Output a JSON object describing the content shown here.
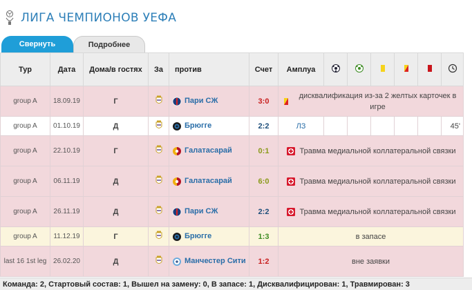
{
  "header": {
    "title": "ЛИГА ЧЕМПИОНОВ УЕФА"
  },
  "tabs": [
    {
      "label": "Свернуть",
      "active": true
    },
    {
      "label": "Подробнее",
      "active": false
    }
  ],
  "columns": {
    "round": "Тур",
    "date": "Дата",
    "home_away": "Дома/в гостях",
    "for": "За",
    "against": "против",
    "score": "Счет",
    "position": "Амплуа"
  },
  "rows": [
    {
      "round": "group A",
      "date": "18.09.19",
      "ha": "Г",
      "opponent": "Пари СЖ",
      "opp_icon": "psg-crest-icon",
      "score": "3:0",
      "score_color": "red",
      "note": "дисквалификация из-за 2 желтых карточек в игре",
      "note_icon": "yellow-red-card-icon",
      "style": "pink"
    },
    {
      "round": "group A",
      "date": "01.10.19",
      "ha": "Д",
      "opponent": "Брюгге",
      "opp_icon": "brugge-crest-icon",
      "score": "2:2",
      "score_color": "navy",
      "position": "ЛЗ",
      "minutes": "45'",
      "style": "white"
    },
    {
      "round": "group A",
      "date": "22.10.19",
      "ha": "Г",
      "opponent": "Галатасарай",
      "opp_icon": "galatasaray-crest-icon",
      "score": "0:1",
      "score_color": "olive",
      "note": "Травма медиальной коллатеральной связки",
      "note_icon": "injury-icon",
      "style": "pink"
    },
    {
      "round": "group A",
      "date": "06.11.19",
      "ha": "Д",
      "opponent": "Галатасарай",
      "opp_icon": "galatasaray-crest-icon",
      "score": "6:0",
      "score_color": "olive",
      "note": "Травма медиальной коллатеральной связки",
      "note_icon": "injury-icon",
      "style": "pink"
    },
    {
      "round": "group A",
      "date": "26.11.19",
      "ha": "Д",
      "opponent": "Пари СЖ",
      "opp_icon": "psg-crest-icon",
      "score": "2:2",
      "score_color": "navy",
      "note": "Травма медиальной коллатеральной связки",
      "note_icon": "injury-icon",
      "style": "pink"
    },
    {
      "round": "group A",
      "date": "11.12.19",
      "ha": "Г",
      "opponent": "Брюгге",
      "opp_icon": "brugge-crest-icon",
      "score": "1:3",
      "score_color": "green",
      "note": "в запасе",
      "style": "yellow"
    },
    {
      "round": "last 16 1st leg",
      "date": "26.02.20",
      "ha": "Д",
      "opponent": "Манчестер Сити",
      "opp_icon": "mancity-crest-icon",
      "score": "1:2",
      "score_color": "red",
      "note": "вне заявки",
      "style": "pink"
    }
  ],
  "footer": {
    "summary": "Команда: 2, Стартовый состав: 1, Вышел на замену: 0, В запасе: 1, Дисквалифицирован: 1, Травмирован: 3"
  },
  "colors": {
    "accent": "#1f9ed8",
    "title": "#2d7fb8",
    "pink_row": "#f2d8dc",
    "yellow_row": "#fbf5dd"
  }
}
